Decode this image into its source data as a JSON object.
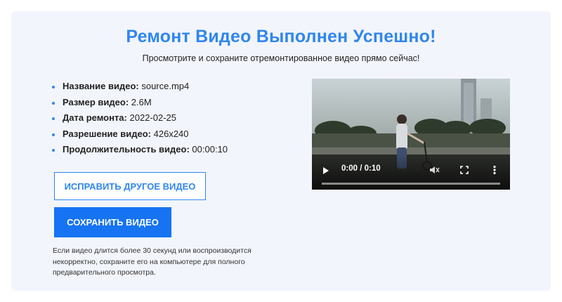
{
  "header": {
    "title": "Ремонт Видео Выполнен Успешно!",
    "subtitle": "Просмотрите и сохраните отремонтированное видео прямо сейчас!"
  },
  "info": [
    {
      "label": "Название видео:",
      "value": "source.mp4"
    },
    {
      "label": "Размер видео:",
      "value": "2.6M"
    },
    {
      "label": "Дата ремонта:",
      "value": "2022-02-25"
    },
    {
      "label": "Разрешение видео:",
      "value": "426x240"
    },
    {
      "label": "Продолжительность видео:",
      "value": "00:00:10"
    }
  ],
  "buttons": {
    "repair_another": "ИСПРАВИТЬ ДРУГОЕ ВИДЕО",
    "save": "СОХРАНИТЬ ВИДЕО"
  },
  "note": "Если видео длится более 30 секунд или воспроизводится некорректно, сохраните его на компьютере для полного предварительного просмотра.",
  "player": {
    "time": "0:00 / 0:10",
    "progress": 0,
    "icons": [
      "play-icon",
      "mute-icon",
      "fullscreen-icon",
      "more-icon"
    ]
  },
  "colors": {
    "accent": "#2f86f0",
    "button": "#1673f2",
    "card_bg": "#f3f5fd"
  }
}
